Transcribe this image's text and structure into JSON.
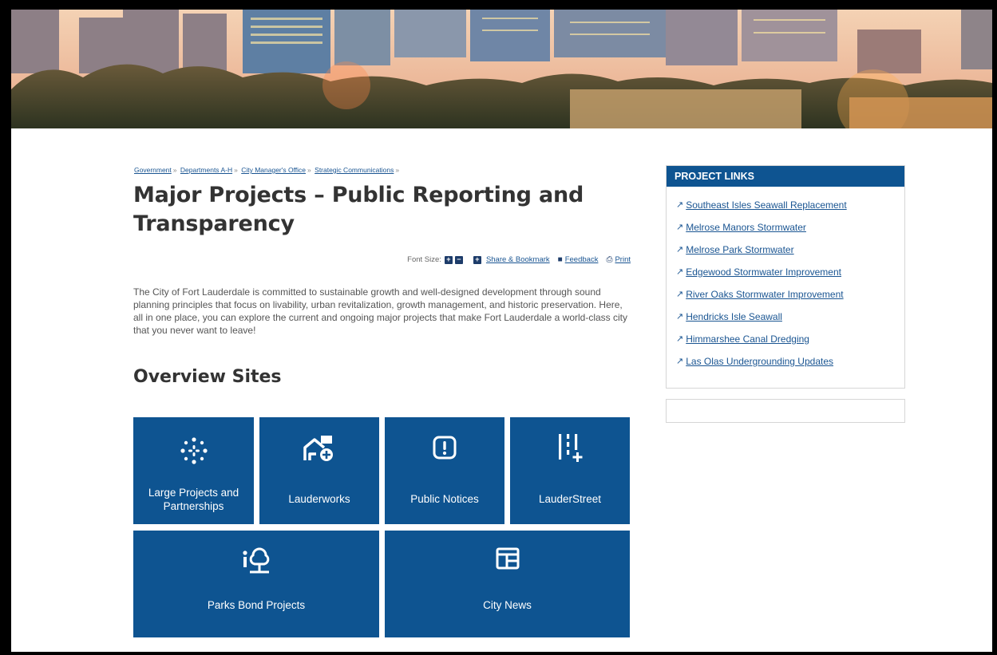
{
  "breadcrumb": [
    {
      "label": "Government"
    },
    {
      "label": "Departments A-H"
    },
    {
      "label": "City Manager's Office"
    },
    {
      "label": "Strategic Communications"
    }
  ],
  "breadcrumb_sep": "»",
  "page": {
    "title": "Major Projects – Public Reporting and Transparency",
    "intro": "The City of Fort Lauderdale is committed to sustainable growth and well-designed development through sound planning principles that focus on livability, urban revitalization, growth management, and historic preservation. Here, all in one place, you can explore the current and ongoing major projects that make Fort Lauderdale a world-class city that you never want to leave!"
  },
  "tools": {
    "font_size_label": "Font Size:",
    "increase": "+",
    "decrease": "−",
    "share": "Share & Bookmark",
    "feedback": "Feedback",
    "print": "Print"
  },
  "overview": {
    "title": "Overview Sites",
    "tiles": [
      {
        "label": "Large Projects and Partnerships",
        "icon": "sparkle-icon"
      },
      {
        "label": "Lauderworks",
        "icon": "house-plus-icon"
      },
      {
        "label": "Public Notices",
        "icon": "alert-icon"
      },
      {
        "label": "LauderStreet",
        "icon": "road-plus-icon"
      },
      {
        "label": "Parks Bond Projects",
        "icon": "park-tree-icon"
      },
      {
        "label": "City News",
        "icon": "newspaper-icon"
      }
    ]
  },
  "sidebar": {
    "title": "PROJECT LINKS",
    "links": [
      "Southeast Isles Seawall Replacement",
      "Melrose Manors Stormwater",
      "Melrose Park Stormwater",
      "Edgewood Stormwater Improvement",
      "River Oaks Stormwater Improvement",
      "Hendricks Isle Seawall",
      "Himmarshee Canal Dredging",
      "Las Olas Undergrounding Updates"
    ]
  },
  "colors": {
    "brand_blue": "#0e5491",
    "link_blue": "#1a5592"
  }
}
